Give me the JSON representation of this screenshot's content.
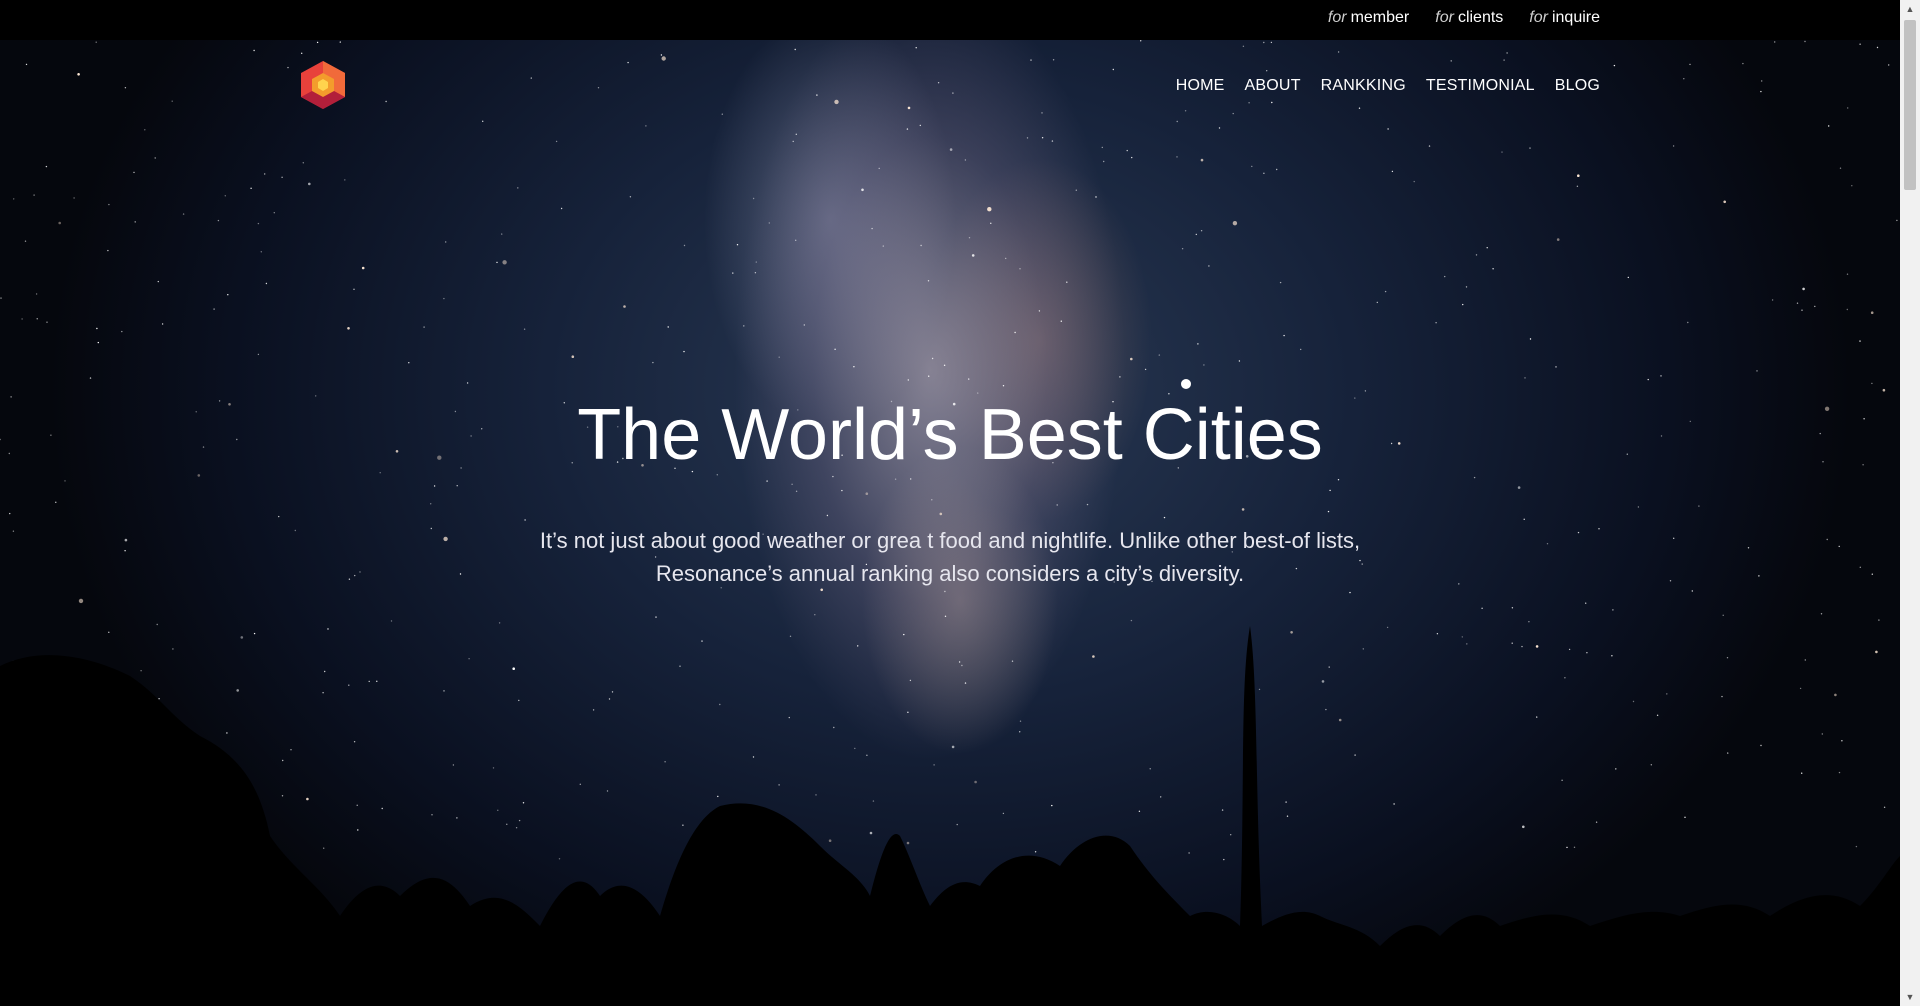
{
  "topbar": {
    "links": [
      {
        "prefix": "for",
        "label": "member"
      },
      {
        "prefix": "for",
        "label": "clients"
      },
      {
        "prefix": "for",
        "label": "inquire"
      }
    ]
  },
  "nav": {
    "items": [
      "HOME",
      "ABOUT",
      "RANKKING",
      "TESTIMONIAL",
      "BLOG"
    ]
  },
  "hero": {
    "title": "The World’s Best Cities",
    "subtitle_line1": "It’s not just about good weather or grea t food and nightlife. Unlike other best-of lists,",
    "subtitle_line2": "Resonance’s annual ranking also considers a city’s diversity."
  },
  "logo": {
    "icon": "hexagon-logo-icon",
    "colors": [
      "#e8413b",
      "#f39c2c",
      "#b21f3a"
    ]
  },
  "scrollbar": {
    "up_icon": "▲",
    "down_icon": "▼"
  }
}
